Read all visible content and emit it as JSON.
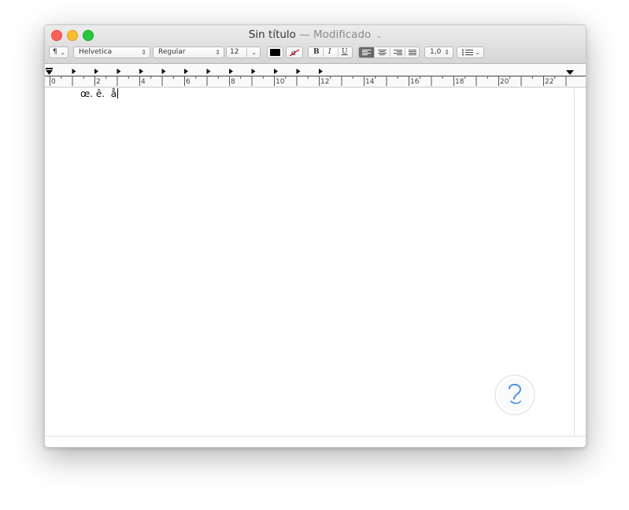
{
  "window": {
    "title": "Sin título",
    "status": "— Modificado",
    "status_chevron": "⌄"
  },
  "toolbar": {
    "paragraph_styles": "¶",
    "font_family": "Helvetica",
    "font_style": "Regular",
    "font_size": "12",
    "text_color": "#000000",
    "bold_label": "B",
    "italic_label": "I",
    "underline_label": "U",
    "line_spacing": "1,0",
    "list_icon": "list-bullets-icon"
  },
  "ruler": {
    "labels": [
      "0",
      "2",
      "4",
      "6",
      "8",
      "10",
      "12",
      "14",
      "16",
      "18",
      "20",
      "22"
    ]
  },
  "document": {
    "text": "œ. ê.  å"
  },
  "colors": {
    "close": "#fc5f57",
    "minimize": "#fdbc2e",
    "zoom": "#27c840",
    "selected_align": "#6b6b6b"
  }
}
